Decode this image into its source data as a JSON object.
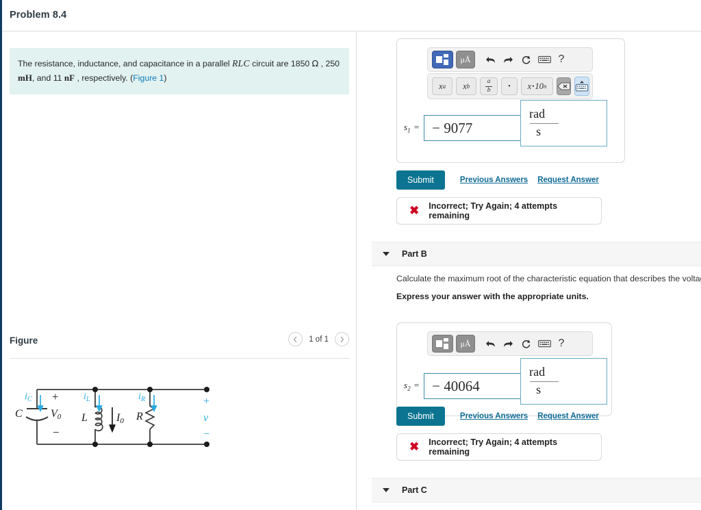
{
  "topbar": {
    "title": "Problem 8.4"
  },
  "prompt": {
    "t1": "The resistance, inductance, and capacitance in a parallel ",
    "rlc": "RLC",
    "t2": " circuit are 1850 ",
    "ohm": "Ω",
    "t3": " , 250 ",
    "mh": "mH",
    "t4": ", and 11 ",
    "nf": "nF",
    "t5": " , respectively. (",
    "figure_link": "Figure 1",
    "t6": ")"
  },
  "figure": {
    "title": "Figure",
    "count": "1 of 1",
    "prev_icon": "chevron-left-icon",
    "next_icon": "chevron-right-icon",
    "circuit": {
      "cap_label": "C",
      "cap_voltage": "V",
      "cap_voltage_sub": "0",
      "cap_plus": "+",
      "cap_minus": "−",
      "ind_label": "L",
      "ind_current": "I",
      "ind_current_sub": "0",
      "res_label": "R",
      "i_c": "i",
      "i_c_sub": "C",
      "i_l": "i",
      "i_l_sub": "L",
      "i_r": "i",
      "i_r_sub": "R",
      "out_plus": "+",
      "out_v": "v",
      "out_minus": "−"
    }
  },
  "mathbar": {
    "template_icon": "template-matrix-icon",
    "units_label": "μÅ",
    "undo_icon": "undo-arrow-icon",
    "redo_icon": "redo-arrow-icon",
    "reset_icon": "reset-circular-arrow-icon",
    "keyboard_icon": "keyboard-icon",
    "help_label": "?",
    "superscript": "x",
    "superscript_exp": "a",
    "subscript": "x",
    "subscript_sub": "b",
    "fraction_num": "a",
    "fraction_den": "b",
    "dot": "•",
    "sci_x": "x",
    "sci_dot": "•",
    "sci_ten": "10",
    "sci_n": "n",
    "backspace_icon": "backspace-icon",
    "keyboard_toggle_icon": "keyboard-up-icon"
  },
  "partA": {
    "answer_label": "s",
    "answer_sub": "1",
    "equals": "=",
    "value": "− 9077",
    "unit_numerator": "rad",
    "unit_denominator": "s",
    "submit_label": "Submit",
    "previous_answers_label": "Previous Answers",
    "request_answer_label": "Request Answer",
    "feedback_icon": "red-x-icon",
    "feedback_text": "Incorrect; Try Again; 4 attempts remaining"
  },
  "partB": {
    "header_title": "Part B",
    "caret_icon": "caret-down-icon",
    "description": "Calculate the maximum root of the characteristic equation that describes the voltage resp",
    "instruction": "Express your answer with the appropriate units.",
    "answer_label": "s",
    "answer_sub": "2",
    "equals": "=",
    "value": "− 40064",
    "unit_numerator": "rad",
    "unit_denominator": "s",
    "submit_label": "Submit",
    "previous_answers_label": "Previous Answers",
    "request_answer_label": "Request Answer",
    "feedback_icon": "red-x-icon",
    "feedback_text": "Incorrect; Try Again; 4 attempts remaining"
  },
  "partC": {
    "header_title": "Part C",
    "caret_icon": "caret-down-icon"
  },
  "colors": {
    "accent_teal": "#0c7490",
    "link_blue": "#0e6a96",
    "prompt_bg": "#e2f2f1",
    "error_red": "#cc0022",
    "rail_navy": "#103c63",
    "circuit_cyan": "#29abe2"
  }
}
